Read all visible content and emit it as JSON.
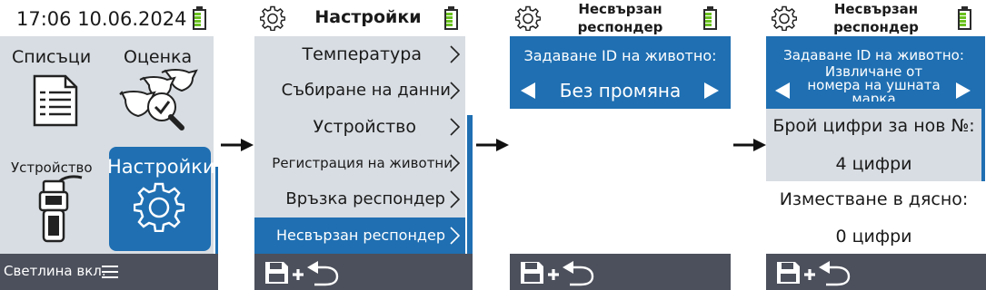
{
  "colors": {
    "accent": "#1f6fb2",
    "panel": "#d8dde3",
    "footer": "#4c505c",
    "battery": "#6ac11f"
  },
  "screen1": {
    "datetime": "17:06 10.06.2024",
    "tiles": [
      {
        "label": "Списъци",
        "icon": "document-list-icon"
      },
      {
        "label": "Оценка",
        "icon": "cattle-evaluation-icon"
      },
      {
        "label": "Устройство",
        "icon": "handheld-reader-icon"
      },
      {
        "label": "Настройки",
        "icon": "gear-icon",
        "selected": true
      }
    ],
    "footer_text": "Светлина вкл.",
    "footer_icon": "menu-icon"
  },
  "screen2": {
    "title": "Настройки",
    "items": [
      "Температура",
      "Събиране на данни",
      "Устройство",
      "Регистрация на животни",
      "Връзка респондер",
      "Несвързан респондер"
    ],
    "selected_index": 5
  },
  "screen3": {
    "title": "Несвързан респондер",
    "field_label": "Задаване ID на животно:",
    "field_value": "Без промяна"
  },
  "screen4": {
    "title": "Несвързан респондер",
    "field_label": "Задаване ID на животно:",
    "field_value": "Извличане от номера на ушната марка",
    "digits_label": "Брой цифри за нов №:",
    "digits_value": "4 цифри",
    "shift_label": "Изместване в дясно:",
    "shift_value": "0 цифри"
  },
  "footer": {
    "icons": [
      "save-icon",
      "plus-icon",
      "back-icon"
    ]
  }
}
